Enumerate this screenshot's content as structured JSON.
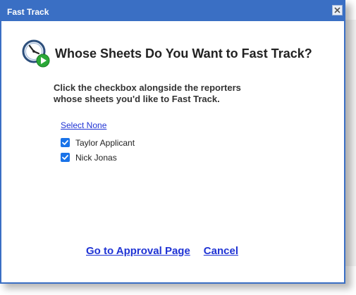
{
  "dialog": {
    "title": "Fast Track",
    "heading": "Whose Sheets Do You Want to Fast Track?",
    "instruction_line1": "Click the checkbox alongside the reporters",
    "instruction_line2": "whose sheets you'd like to Fast Track.",
    "select_none_label": "Select None",
    "reporters": [
      {
        "name": "Taylor Applicant",
        "checked": true
      },
      {
        "name": "Nick Jonas",
        "checked": true
      }
    ],
    "approval_link": "Go to Approval Page",
    "cancel_link": "Cancel"
  },
  "icons": {
    "clock": "clock-play-icon",
    "close": "close-icon",
    "check": "checkmark-icon"
  },
  "colors": {
    "titlebar": "#3a6fc4",
    "link": "#1f33d4",
    "checkbox": "#1a73e8"
  }
}
